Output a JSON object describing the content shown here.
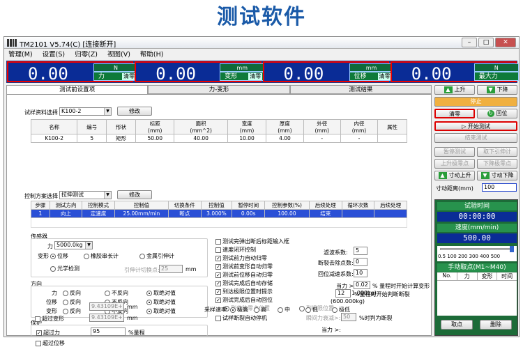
{
  "heading": "测试软件",
  "window": {
    "title": "TM2101  V5.74(C)  [连接断开]"
  },
  "menu": [
    "管理(M)",
    "设置(S)",
    "归零(Z)",
    "视图(V)",
    "帮助(H)"
  ],
  "displays": [
    {
      "value": "0.00",
      "unit": "N",
      "label": "力",
      "clear": "清零"
    },
    {
      "value": "0.00",
      "unit": "mm",
      "label": "变形",
      "clear": "清零"
    },
    {
      "value": "0.00",
      "unit": "mm",
      "label": "位移",
      "clear": "清零"
    },
    {
      "value": "0.00",
      "unit": "N",
      "label": "最大力",
      "clear": ""
    }
  ],
  "tabs": [
    "测试前设置项",
    "力-变形",
    "测试结果"
  ],
  "sample": {
    "label": "试样资料选择",
    "value": "K100-2",
    "modify": "修改",
    "headers": [
      "名称",
      "编号",
      "形状",
      "标距\n(mm)",
      "面积\n(mm^2)",
      "宽度\n(mm)",
      "厚度\n(mm)",
      "外径\n(mm)",
      "内径\n(mm)",
      "属性"
    ],
    "row": [
      "K100-2",
      "5",
      "矩形",
      "50.00",
      "40.00",
      "10.00",
      "4.00",
      "-",
      "-",
      ""
    ]
  },
  "control": {
    "label": "控制方案选择",
    "value": "拉伸测试",
    "modify": "修改",
    "headers": [
      "步骤",
      "测试方向",
      "控制模式",
      "控制值",
      "切换条件",
      "控制值",
      "暂停时间",
      "控制参数(%)",
      "后续处理",
      "循环次数",
      "后续处理"
    ],
    "row": [
      "1",
      "向上",
      "定速度",
      "25.00mm/min",
      "断点",
      "3.000%",
      "0.00s",
      "100.00",
      "结束",
      "",
      ""
    ]
  },
  "sensor": {
    "title": "传感器",
    "force_label": "力",
    "force_value": "5000.0kg",
    "deform_label": "变形",
    "opt_disp": "位移",
    "opt_rubber": "橡胶串长计",
    "opt_metal": "金属引伸计",
    "opt_optical": "光学检测",
    "extens_label": "引伸计切换点:",
    "extens_value": "25",
    "extens_unit": "mm"
  },
  "direction": {
    "title": "方向",
    "rows": [
      "力",
      "位移",
      "变形"
    ],
    "opt1": "反向",
    "opt2": "不反向",
    "opt3": "取绝对值"
  },
  "protect": {
    "title": "保护",
    "items": [
      {
        "label": "超过力",
        "value": "95",
        "unit": "%量程"
      },
      {
        "label": "超过位移",
        "value": "9.43109E+",
        "unit": "mm"
      },
      {
        "label": "超过变形",
        "value": "9.43109E+",
        "unit": "mm"
      }
    ]
  },
  "options": [
    "测试完弹出断后标距输入框",
    "速度闭环控制",
    "测试前力自动归零",
    "测试前变形自动归零",
    "测试前位移自动归零",
    "测试完成后自动存储",
    "到达极限位置时提示",
    "测试完成后自动回位",
    "到位移零点位置",
    "试样断裂自动停机"
  ],
  "options_checked": [
    false,
    false,
    true,
    true,
    true,
    true,
    true,
    true,
    false,
    false
  ],
  "limit_pos": "到极限位置",
  "params": {
    "filter": "滤波系数:",
    "filter_val": "5",
    "denoise": "断裂去除点数:",
    "denoise_val": "0",
    "return": "回位减速系数:",
    "return_val": "10",
    "force_gt": "当力 >",
    "force_gt_val": "0.02",
    "force_gt_tail": "% 量程时开始计算变形",
    "force_gt_kg": "(1.000kg)",
    "decay": "瞬间力衰减>:",
    "decay_val": "50",
    "decay_tail": "%时判为断裂",
    "force_gt2": "当力 >:",
    "force_gt2_val": "12",
    "force_gt2_tail": "%量程时开始判断断裂",
    "force_gt2_kg": "(600.000kg)"
  },
  "sampling": {
    "label": "采样速率",
    "options": [
      "极高",
      "高",
      "中",
      "低",
      "极低"
    ]
  },
  "right": {
    "up": "上升",
    "down": "下降",
    "stop": "停止",
    "zero": "清零",
    "return": "回位",
    "start": "开始测试",
    "end": "结束测试",
    "pause": "暂停测试",
    "remove_ext": "取下引伸计",
    "upper_limit": "上升极零点",
    "lower_limit": "下降极零点",
    "jog_up": "寸动上升",
    "jog_down": "寸动下降",
    "jog_dist": "寸动距离(mm)",
    "jog_val": "100"
  },
  "test_time": {
    "title": "试验时间",
    "value": "00:00:00",
    "speed_title": "速度(mm/min)",
    "speed_value": "500.00",
    "scale": "0.5 100 200 300 400 500",
    "manual": "手动取点(M1~M40)",
    "manual_headers": [
      "No.",
      "力",
      "变形",
      "时间"
    ]
  },
  "bottom": {
    "remove": "取点",
    "delete": "删除"
  }
}
